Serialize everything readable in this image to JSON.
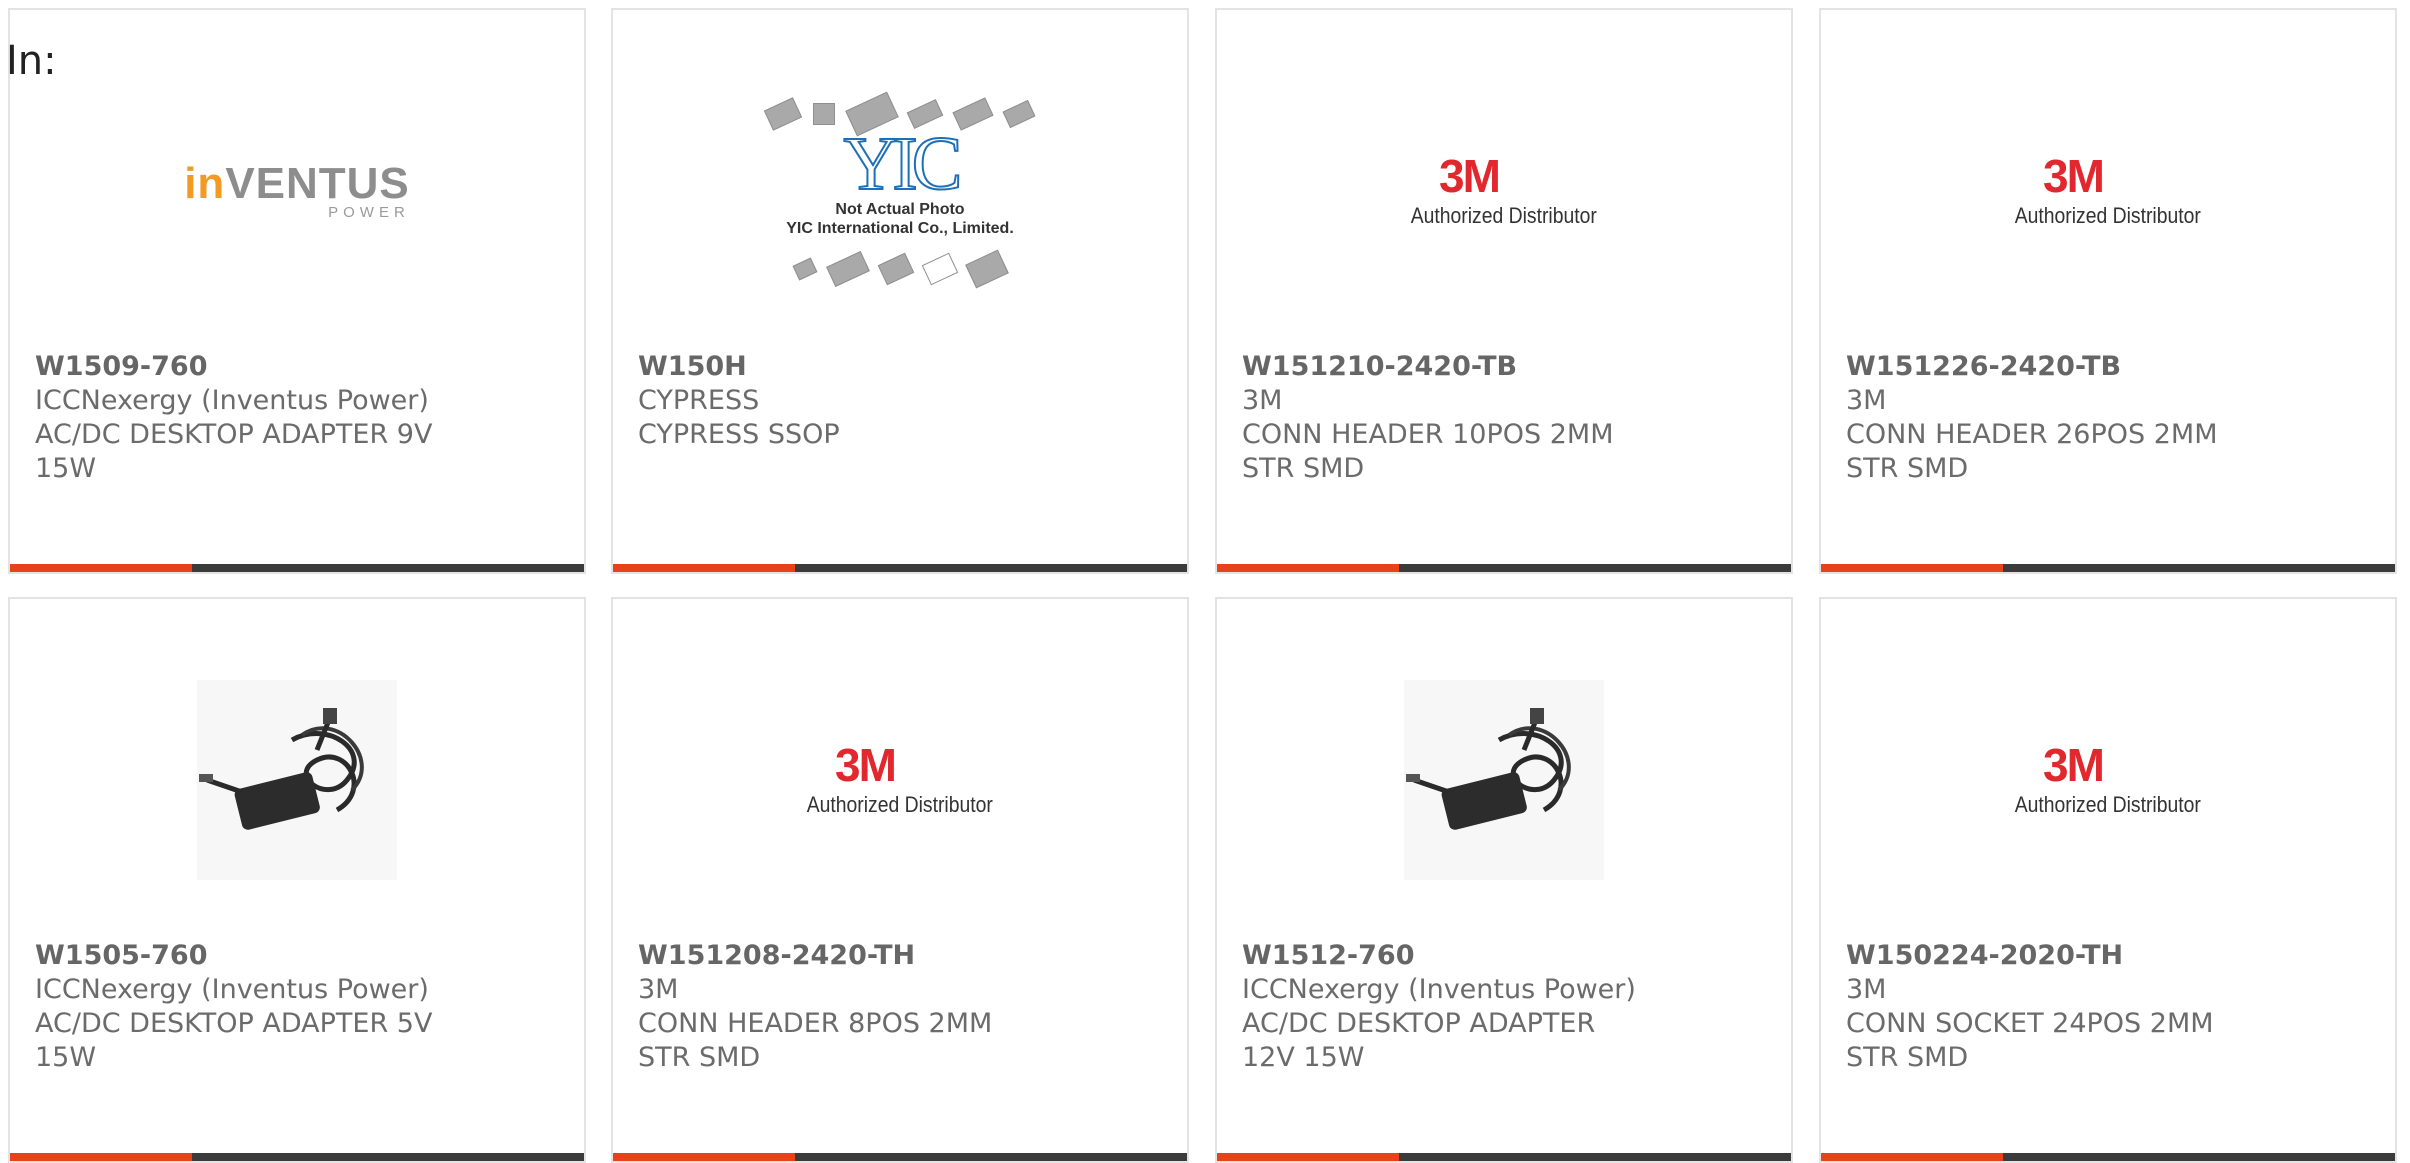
{
  "filter": {
    "label": "In:"
  },
  "products": [
    {
      "part_number": "W1509-760",
      "manufacturer": "ICCNexergy (Inventus Power)",
      "description": "AC/DC DESKTOP ADAPTER 9V 15W",
      "image": "inventus-logo"
    },
    {
      "part_number": "W150H",
      "manufacturer": "CYPRESS",
      "description": "CYPRESS SSOP",
      "image": "yic-not-actual-photo"
    },
    {
      "part_number": "W151210-2420-TB",
      "manufacturer": "3M",
      "description": "CONN HEADER 10POS 2MM STR SMD",
      "image": "3m-logo"
    },
    {
      "part_number": "W151226-2420-TB",
      "manufacturer": "3M",
      "description": "CONN HEADER 26POS 2MM STR SMD",
      "image": "3m-logo"
    },
    {
      "part_number": "W1505-760",
      "manufacturer": "ICCNexergy (Inventus Power)",
      "description": "AC/DC DESKTOP ADAPTER 5V 15W",
      "image": "power-adapter-photo"
    },
    {
      "part_number": "W151208-2420-TH",
      "manufacturer": "3M",
      "description": "CONN HEADER 8POS 2MM STR SMD",
      "image": "3m-logo"
    },
    {
      "part_number": "W1512-760",
      "manufacturer": "ICCNexergy (Inventus Power)",
      "description": "AC/DC DESKTOP ADAPTER 12V 15W",
      "image": "power-adapter-photo"
    },
    {
      "part_number": "W150224-2020-TH",
      "manufacturer": "3M",
      "description": "CONN SOCKET 24POS 2MM STR SMD",
      "image": "3m-logo"
    }
  ],
  "logos": {
    "three_m": {
      "mark": "3M",
      "sub": "Authorized Distributor"
    },
    "inventus": {
      "mark_orange": "in",
      "mark_gray": "VENTUS",
      "sub": "POWER"
    },
    "yic": {
      "mark": "YIC",
      "line1": "Not Actual Photo",
      "line2": "YIC International Co., Limited."
    }
  },
  "colors": {
    "accent_bar": "#e8421a",
    "dark_bar": "#3b3b3b",
    "text": "#6b6b6b",
    "border": "#e3e3e3",
    "brand_3m": "#e0282e",
    "brand_inventus": "#f39a24",
    "brand_yic": "#1d6fb8"
  }
}
